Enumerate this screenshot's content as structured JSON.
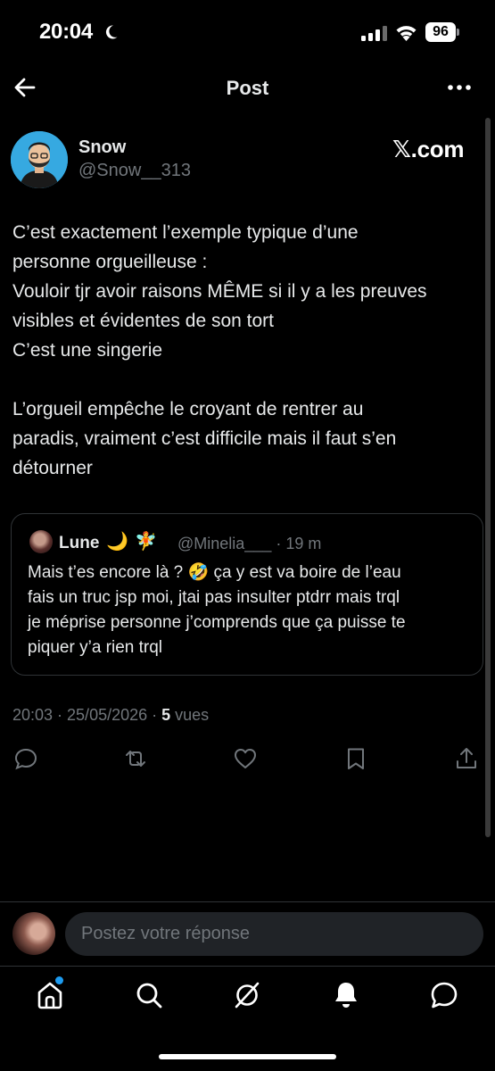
{
  "status_bar": {
    "time": "20:04",
    "battery": "96"
  },
  "header": {
    "title": "Post"
  },
  "post": {
    "author_name": "Snow",
    "author_handle": "@Snow__313",
    "brand": "𝕏.com",
    "text": "C’est exactement l’exemple typique d’une\npersonne orgueilleuse :\nVouloir tjr avoir raisons MÊME si il y a les preuves\nvisibles et évidentes de son tort\nC’est une singerie\n\nL’orgueil empêche le croyant de rentrer au\nparadis, vraiment c’est difficile mais il faut s’en\ndétourner",
    "timestamp": "20:03 · 25/05/2026 · ",
    "views_count": "5",
    "views_label": " vues"
  },
  "quote": {
    "name": "Lune",
    "emoji_1": "🌙",
    "emoji_2": "🧚",
    "handle_time": "@Minelia___ · 19 m",
    "text": "Mais t’es encore là ? 🤣 ça y est va boire de l’eau\nfais un truc jsp moi, jtai pas insulter ptdrr mais trql\nje méprise personne j’comprends que ça puisse te\npiquer y’a rien trql"
  },
  "reply": {
    "placeholder": "Postez votre réponse"
  },
  "colors": {
    "background": "#000000",
    "text": "#e7e9ea",
    "muted": "#71767b",
    "accent": "#1d9bf0",
    "divider": "#2f3336"
  },
  "icons": {
    "actions": [
      "reply-icon",
      "repost-icon",
      "like-icon",
      "bookmark-icon",
      "share-icon"
    ],
    "nav": [
      "home-icon",
      "search-icon",
      "grok-icon",
      "notifications-icon",
      "messages-icon"
    ]
  }
}
